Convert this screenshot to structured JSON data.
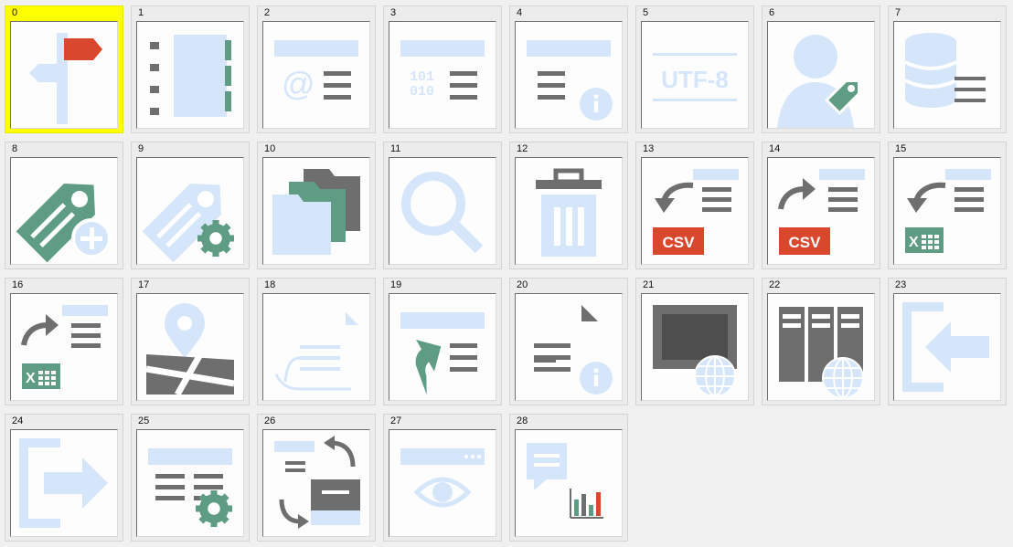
{
  "colors": {
    "selected": "#ffff00",
    "light_blue": "#d5e6fb",
    "green": "#5e9c84",
    "gray": "#6e6e6e",
    "red": "#d9482c"
  },
  "selected_index": 0,
  "icons": [
    {
      "index": "0",
      "name": "signpost-icon"
    },
    {
      "index": "1",
      "name": "address-book-icon"
    },
    {
      "index": "2",
      "name": "email-list-icon"
    },
    {
      "index": "3",
      "name": "binary-list-icon"
    },
    {
      "index": "4",
      "name": "list-info-icon"
    },
    {
      "index": "5",
      "name": "encoding-icon",
      "text": "UTF-8"
    },
    {
      "index": "6",
      "name": "user-tag-icon"
    },
    {
      "index": "7",
      "name": "database-list-icon"
    },
    {
      "index": "8",
      "name": "add-tag-icon"
    },
    {
      "index": "9",
      "name": "tag-settings-icon"
    },
    {
      "index": "10",
      "name": "folders-icon"
    },
    {
      "index": "11",
      "name": "search-icon"
    },
    {
      "index": "12",
      "name": "trash-icon"
    },
    {
      "index": "13",
      "name": "import-csv-icon",
      "text": "CSV"
    },
    {
      "index": "14",
      "name": "export-csv-icon",
      "text": "CSV"
    },
    {
      "index": "15",
      "name": "import-excel-icon"
    },
    {
      "index": "16",
      "name": "export-excel-icon"
    },
    {
      "index": "17",
      "name": "map-pin-icon"
    },
    {
      "index": "18",
      "name": "document-scroll-icon"
    },
    {
      "index": "19",
      "name": "upload-list-icon"
    },
    {
      "index": "20",
      "name": "document-info-icon"
    },
    {
      "index": "21",
      "name": "web-screen-icon"
    },
    {
      "index": "22",
      "name": "web-servers-icon"
    },
    {
      "index": "23",
      "name": "login-icon"
    },
    {
      "index": "24",
      "name": "logout-icon"
    },
    {
      "index": "25",
      "name": "list-settings-icon"
    },
    {
      "index": "26",
      "name": "sync-inbox-icon"
    },
    {
      "index": "27",
      "name": "browser-preview-icon"
    },
    {
      "index": "28",
      "name": "report-chart-icon"
    }
  ]
}
